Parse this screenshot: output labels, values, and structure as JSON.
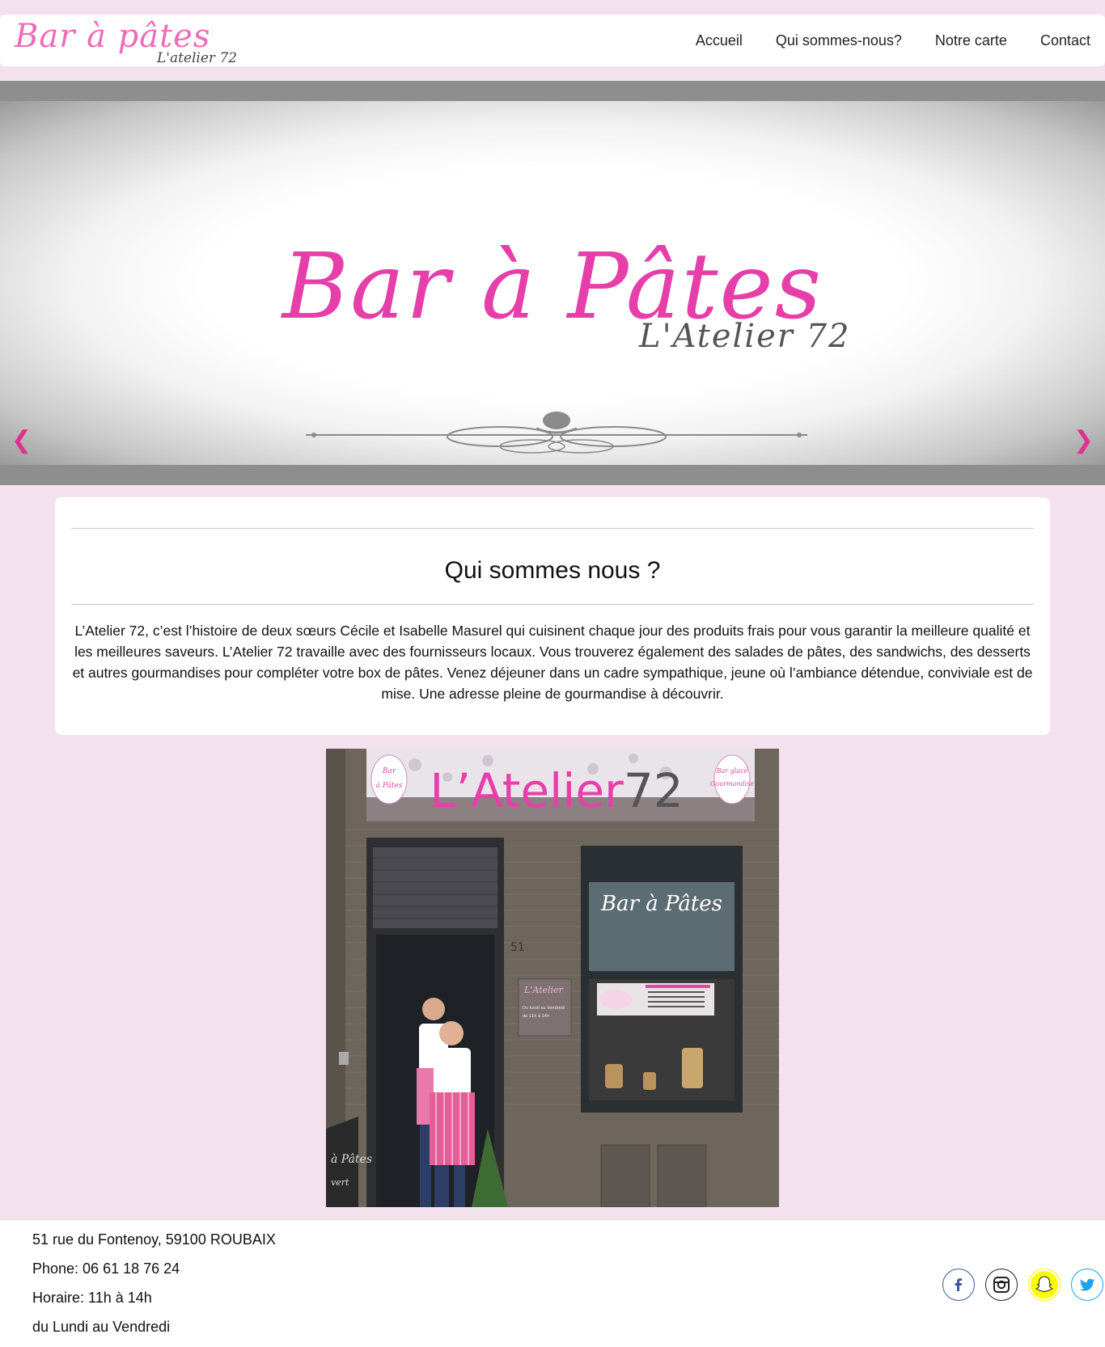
{
  "header": {
    "logo_main": "Bar à pâtes",
    "logo_sub": "L'atelier 72",
    "nav": [
      {
        "label": "Accueil"
      },
      {
        "label": "Qui sommes-nous?"
      },
      {
        "label": "Notre carte"
      },
      {
        "label": "Contact"
      }
    ]
  },
  "hero": {
    "title": "Bar à Pâtes",
    "subtitle": "L'Atelier 72",
    "prev_icon": "chevron-left-icon",
    "next_icon": "chevron-right-icon",
    "arrow_color": "#e1308f",
    "prev_glyph": "❮",
    "next_glyph": "❯"
  },
  "about": {
    "title": "Qui sommes nous ?",
    "text": "L’Atelier 72, c’est l’histoire de deux sœurs Cécile et Isabelle Masurel qui cuisinent chaque jour des produits frais pour vous garantir la meilleure qualité et les meilleures saveurs. L’Atelier 72 travaille avec des fournisseurs locaux. Vous trouverez également des salades de pâtes, des sandwichs, des desserts et autres gourmandises pour compléter votre box de pâtes. Venez déjeuner dans un cadre sympathique, jeune où l’ambiance détendue, conviviale est de mise. Une adresse pleine de gourmandise à découvrir."
  },
  "photo": {
    "sign_text": "L’Atelier72",
    "sign_left": "Bar à Pâtes",
    "sign_right": "Bar glacé et Gourmandise",
    "window_text": "Bar à Pâtes",
    "door_number": "51",
    "panel_title": "L'Atelier",
    "panel_text": "Du lundi au Vendredi de 11h à 14h",
    "chalkboard_text": "à Pâtes",
    "chalkboard_sub": "vert"
  },
  "footer": {
    "address": "51 rue du Fontenoy, 59100 ROUBAIX",
    "phone": "Phone: 06 61 18 76 24",
    "hours": "Horaire: 11h à 14h",
    "days": "du Lundi au Vendredi",
    "social": [
      {
        "name": "facebook-icon",
        "color": "#3b5998"
      },
      {
        "name": "instagram-icon",
        "color": "#222222"
      },
      {
        "name": "snapchat-icon",
        "color": "#fffc00"
      },
      {
        "name": "twitter-icon",
        "color": "#1da1f2"
      }
    ]
  },
  "colors": {
    "page_background": "#f3e1ee",
    "brand_pink": "#e63fa9"
  }
}
